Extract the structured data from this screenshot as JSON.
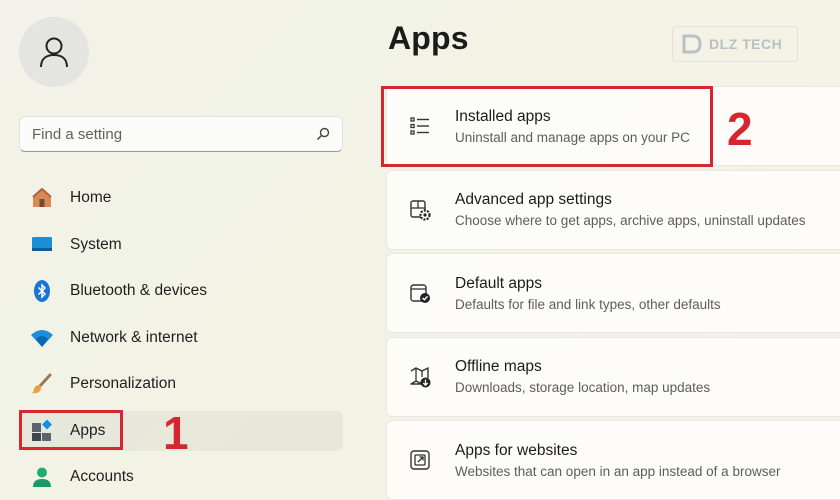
{
  "sidebar": {
    "search_placeholder": "Find a setting",
    "items": [
      {
        "label": "Home",
        "icon": "home-icon"
      },
      {
        "label": "System",
        "icon": "system-icon"
      },
      {
        "label": "Bluetooth & devices",
        "icon": "bluetooth-icon"
      },
      {
        "label": "Network & internet",
        "icon": "wifi-icon"
      },
      {
        "label": "Personalization",
        "icon": "brush-icon"
      },
      {
        "label": "Apps",
        "icon": "apps-icon",
        "active": true
      },
      {
        "label": "Accounts",
        "icon": "accounts-icon"
      }
    ]
  },
  "main": {
    "title": "Apps",
    "cards": [
      {
        "title": "Installed apps",
        "subtitle": "Uninstall and manage apps on your PC",
        "icon": "list-icon"
      },
      {
        "title": "Advanced app settings",
        "subtitle": "Choose where to get apps, archive apps, uninstall updates",
        "icon": "app-settings-icon"
      },
      {
        "title": "Default apps",
        "subtitle": "Defaults for file and link types, other defaults",
        "icon": "default-apps-icon"
      },
      {
        "title": "Offline maps",
        "subtitle": "Downloads, storage location, map updates",
        "icon": "map-icon"
      },
      {
        "title": "Apps for websites",
        "subtitle": "Websites that can open in an app instead of a browser",
        "icon": "open-external-icon"
      }
    ]
  },
  "annotations": {
    "step1": "1",
    "step2": "2"
  },
  "watermark": {
    "text": "DLZ TECH"
  },
  "colors": {
    "accent": "#005fb8",
    "annotation_red": "#d6262f"
  }
}
